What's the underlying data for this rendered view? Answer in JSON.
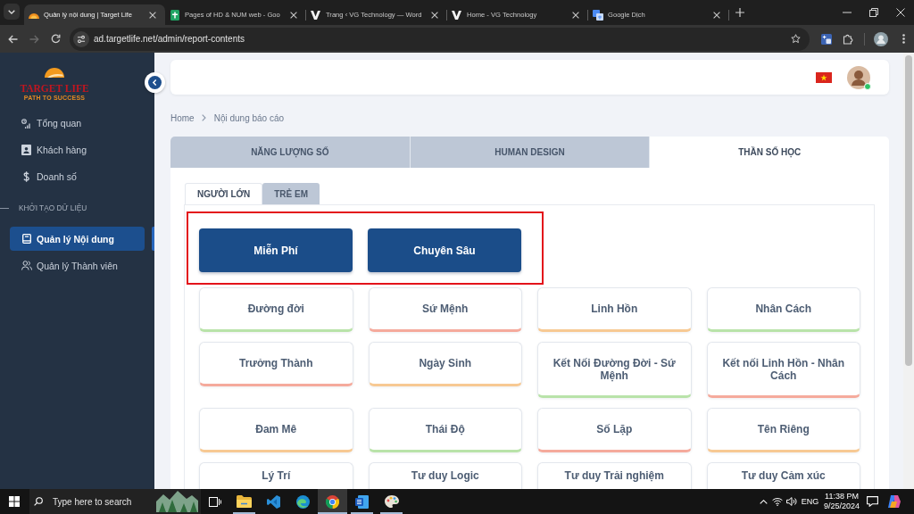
{
  "browser": {
    "tabs": [
      {
        "title": "Quản lý nội dung | Target Life",
        "kind": "sun",
        "selected": true
      },
      {
        "title": "Pages of HD & NUM web - Goo",
        "kind": "sheets",
        "selected": false
      },
      {
        "title": "Trang ‹ VG Technology — Word",
        "kind": "v",
        "selected": false
      },
      {
        "title": "Home - VG Technology",
        "kind": "v",
        "selected": false
      },
      {
        "title": "Google Dịch",
        "kind": "translate",
        "selected": false
      }
    ],
    "nav_buttons": [
      {
        "kind": "back",
        "disabled": false
      },
      {
        "kind": "forward",
        "disabled": true
      },
      {
        "kind": "reload",
        "disabled": false
      }
    ],
    "url": "ad.targetlife.net/admin/report-contents"
  },
  "sidebar": {
    "logo": {
      "name": "TARGET LIFE",
      "tagline": "PATH TO SUCCESS"
    },
    "items": [
      {
        "label": "Tổng quan",
        "kind": "chart",
        "selected": false
      },
      {
        "label": "Khách hàng",
        "kind": "contact",
        "selected": false
      },
      {
        "label": "Doanh số",
        "kind": "dollar",
        "selected": false
      }
    ],
    "groups": [
      {
        "title": "KHỞI TẠO DỮ LIỆU",
        "items": [
          {
            "label": "Quản lý Nội dung",
            "kind": "book",
            "selected": true
          },
          {
            "label": "Quản lý Thành viên",
            "kind": "users",
            "selected": false
          }
        ]
      }
    ]
  },
  "header": {
    "avatar": {
      "online": true
    }
  },
  "breadcrumb": [
    "Home",
    "Nội dung báo cáo"
  ],
  "report_tabs": [
    {
      "label": "NĂNG LƯỢNG SỐ",
      "selected": false
    },
    {
      "label": "HUMAN DESIGN",
      "selected": false
    },
    {
      "label": "THẦN SỐ HỌC",
      "selected": true
    }
  ],
  "audience_tabs": [
    {
      "label": "NGƯỜI LỚN",
      "selected": true
    },
    {
      "label": "TRẺ EM",
      "selected": false
    }
  ],
  "plans": {
    "highlighted": true,
    "buttons": [
      "Miễn Phí",
      "Chuyên Sâu"
    ]
  },
  "topics": [
    {
      "label": "Đường đời",
      "color": "#b9e3a9"
    },
    {
      "label": "Sứ Mệnh",
      "color": "#f5aa9c"
    },
    {
      "label": "Linh Hồn",
      "color": "#f7c993"
    },
    {
      "label": "Nhân Cách",
      "color": "#b9e3a9"
    },
    {
      "label": "Trưởng Thành",
      "color": "#f5aa9c"
    },
    {
      "label": "Ngày Sinh",
      "color": "#f7c993"
    },
    {
      "label": "Kết Nối Đường Đời - Sứ Mệnh",
      "color": "#b9e3a9"
    },
    {
      "label": "Kết nối Linh Hồn - Nhân Cách",
      "color": "#f5aa9c"
    },
    {
      "label": "Đam Mê",
      "color": "#f7c993"
    },
    {
      "label": "Thái Độ",
      "color": "#b9e3a9"
    },
    {
      "label": "Số Lặp",
      "color": "#f5aa9c"
    },
    {
      "label": "Tên Riêng",
      "color": "#f7c993"
    },
    {
      "label": "Lý Trí"
    },
    {
      "label": "Tư duy Logic"
    },
    {
      "label": "Tư duy Trải nghiệm"
    },
    {
      "label": "Tư duy Cảm xúc"
    }
  ],
  "taskbar": {
    "search": {
      "placeholder": "Type here to search"
    },
    "apps": [
      {
        "kind": "explorer",
        "running": true,
        "selected": false
      },
      {
        "kind": "vscode",
        "running": false,
        "selected": false
      },
      {
        "kind": "edge",
        "running": false,
        "selected": false
      },
      {
        "kind": "chrome",
        "running": true,
        "selected": true
      },
      {
        "kind": "word",
        "running": true,
        "selected": false
      },
      {
        "kind": "paint",
        "running": true,
        "selected": false
      }
    ],
    "language": "ENG",
    "time": "11:38 PM",
    "date": "9/25/2024"
  }
}
